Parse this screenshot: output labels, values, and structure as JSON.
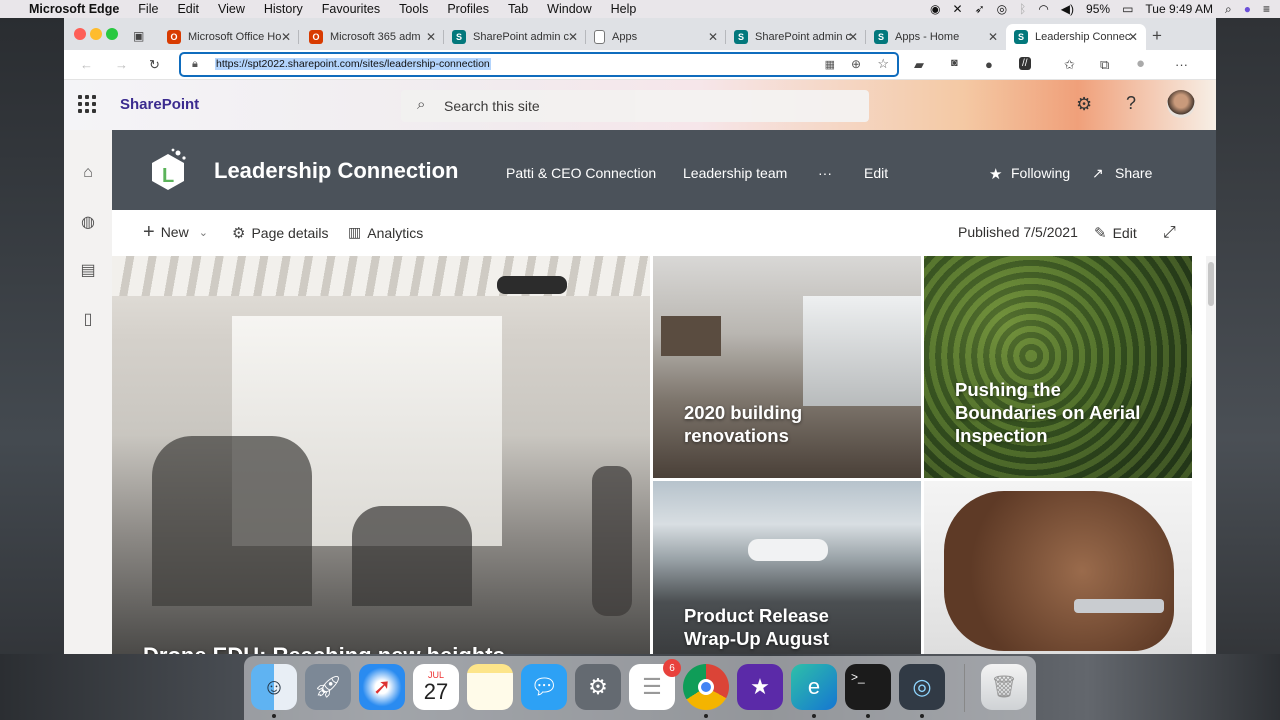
{
  "menubar": {
    "app": "Microsoft Edge",
    "items": [
      "File",
      "Edit",
      "View",
      "History",
      "Favourites",
      "Tools",
      "Profiles",
      "Tab",
      "Window",
      "Help"
    ],
    "battery": "95%",
    "clock": "Tue 9:49 AM"
  },
  "tabs": [
    {
      "title": "Microsoft Office Ho",
      "favicon": "office-icon",
      "color": "#d83b01"
    },
    {
      "title": "Microsoft 365 adm",
      "favicon": "office-icon",
      "color": "#d83b01"
    },
    {
      "title": "SharePoint admin c",
      "favicon": "sharepoint-icon",
      "color": "#03787c"
    },
    {
      "title": "Apps",
      "favicon": "page-icon",
      "color": "#888888"
    },
    {
      "title": "SharePoint admin c",
      "favicon": "sharepoint-icon",
      "color": "#03787c"
    },
    {
      "title": "Apps - Home",
      "favicon": "sharepoint-icon",
      "color": "#03787c"
    },
    {
      "title": "Leadership Connec",
      "favicon": "sharepoint-icon",
      "color": "#03787c"
    }
  ],
  "address": {
    "url": "https://spt2022.sharepoint.com/sites/leadership-connection"
  },
  "suite": {
    "app_name": "SharePoint",
    "search_placeholder": "Search this site"
  },
  "site": {
    "title": "Leadership Connection",
    "nav": [
      "Patti & CEO Connection",
      "Leadership team",
      "···",
      "Edit"
    ],
    "following": "Following",
    "share": "Share"
  },
  "commandbar": {
    "new": "New",
    "page_details": "Page details",
    "analytics": "Analytics",
    "published": "Published 7/5/2021",
    "edit": "Edit"
  },
  "hero": [
    {
      "caption": "Drone EDU: Reaching new heights"
    },
    {
      "caption_line1": "2020 building",
      "caption_line2": "renovations"
    },
    {
      "caption_line1": "Pushing the",
      "caption_line2": "Boundaries on Aerial",
      "caption_line3": "Inspection"
    },
    {
      "caption_line1": "Product Release",
      "caption_line2": "Wrap-Up August"
    },
    {
      "caption": ""
    }
  ],
  "dock": {
    "calendar_month": "JUL",
    "calendar_day": "27",
    "reminders_badge": "6"
  },
  "colors": {
    "sharepoint_purple": "#3b2b8f",
    "header_bg": "#4b525a",
    "accent": "#0f6cbd"
  }
}
